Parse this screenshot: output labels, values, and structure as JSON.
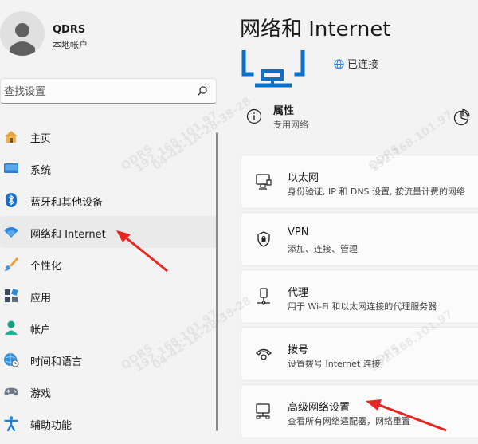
{
  "user": {
    "name": "QDRS",
    "type": "本地帐户"
  },
  "search": {
    "placeholder": "查找设置"
  },
  "nav": {
    "items": [
      {
        "label": "主页",
        "icon": "home-icon"
      },
      {
        "label": "系统",
        "icon": "system-monitor-icon"
      },
      {
        "label": "蓝牙和其他设备",
        "icon": "bluetooth-icon"
      },
      {
        "label": "网络和 Internet",
        "icon": "wifi-icon",
        "active": true
      },
      {
        "label": "个性化",
        "icon": "paintbrush-icon"
      },
      {
        "label": "应用",
        "icon": "apps-icon"
      },
      {
        "label": "帐户",
        "icon": "account-icon"
      },
      {
        "label": "时间和语言",
        "icon": "globe-clock-icon"
      },
      {
        "label": "游戏",
        "icon": "gamepad-icon"
      },
      {
        "label": "辅助功能",
        "icon": "accessibility-icon"
      }
    ]
  },
  "main": {
    "title": "网络和 Internet",
    "status": "已连接",
    "properties": {
      "title": "属性",
      "subtitle": "专用网络"
    },
    "cards": [
      {
        "title": "以太网",
        "subtitle": "身份验证, IP 和 DNS 设置, 按流量计费的网络",
        "icon": "ethernet-icon"
      },
      {
        "title": "VPN",
        "subtitle": "添加、连接、管理",
        "icon": "vpn-shield-icon"
      },
      {
        "title": "代理",
        "subtitle": "用于 Wi-Fi 和以太网连接的代理服务器",
        "icon": "proxy-icon"
      },
      {
        "title": "拨号",
        "subtitle": "设置拨号 Internet 连接",
        "icon": "dialup-icon"
      },
      {
        "title": "高级网络设置",
        "subtitle": "查看所有网络适配器，网络重置",
        "icon": "advanced-network-icon"
      }
    ]
  },
  "watermark": {
    "lines": [
      "QDRS",
      "192.168.101.97",
      "04-42-1A-28-38-28"
    ]
  },
  "colors": {
    "accent": "#0067c0",
    "arrow": "#e8251f"
  }
}
